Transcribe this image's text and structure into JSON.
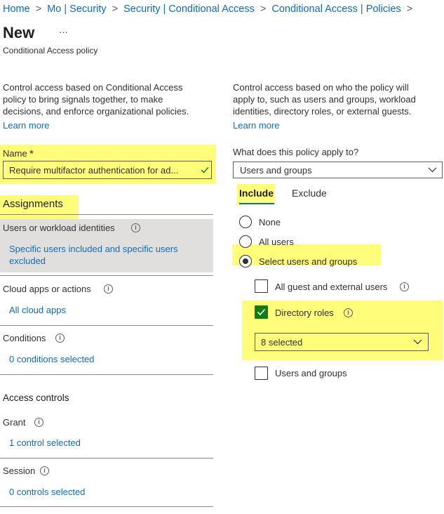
{
  "breadcrumb": {
    "items": [
      "Home",
      "Mo | Security",
      "Security | Conditional Access",
      "Conditional Access | Policies"
    ],
    "separator": ">"
  },
  "header": {
    "title": "New",
    "more": "···",
    "subtitle": "Conditional Access policy"
  },
  "left": {
    "intro": [
      "Control access based on Conditional Access",
      "policy to bring signals together, to make",
      "decisions, and enforce organizational policies."
    ],
    "learn_more": "Learn more",
    "name_label": "Name",
    "required_mark": "*",
    "name_value": "Require multifactor authentication for ad...",
    "assignments_heading": "Assignments",
    "users_label": "Users or workload identities",
    "users_value": [
      "Specific users included and specific users",
      "excluded"
    ],
    "cloud_label": "Cloud apps or actions",
    "cloud_value": "All cloud apps",
    "conditions_label": "Conditions",
    "conditions_value": "0 conditions selected",
    "access_heading": "Access controls",
    "grant_label": "Grant",
    "grant_value": "1 control selected",
    "session_label": "Session",
    "session_value": "0 controls selected"
  },
  "right": {
    "intro": [
      "Control access based on who the policy will",
      "apply to, such as users and groups, workload",
      "identities, directory roles, or external guests."
    ],
    "learn_more": "Learn more",
    "apply_label": "What does this policy apply to?",
    "apply_value": "Users and groups",
    "tabs": [
      "Include",
      "Exclude"
    ],
    "radios": [
      "None",
      "All users",
      "Select users and groups"
    ],
    "selected_radio": "Select users and groups",
    "checkboxes": [
      {
        "label": "All guest and external users",
        "checked": false
      },
      {
        "label": "Directory roles",
        "checked": true
      },
      {
        "label": "Users and groups",
        "checked": false
      }
    ],
    "roles_value": "8 selected"
  },
  "colors": {
    "link": "#0f6cbd",
    "highlight": "#fffd7a",
    "checked": "#107c10",
    "required": "#a4262c",
    "selected_row": "#e1dfdd"
  }
}
